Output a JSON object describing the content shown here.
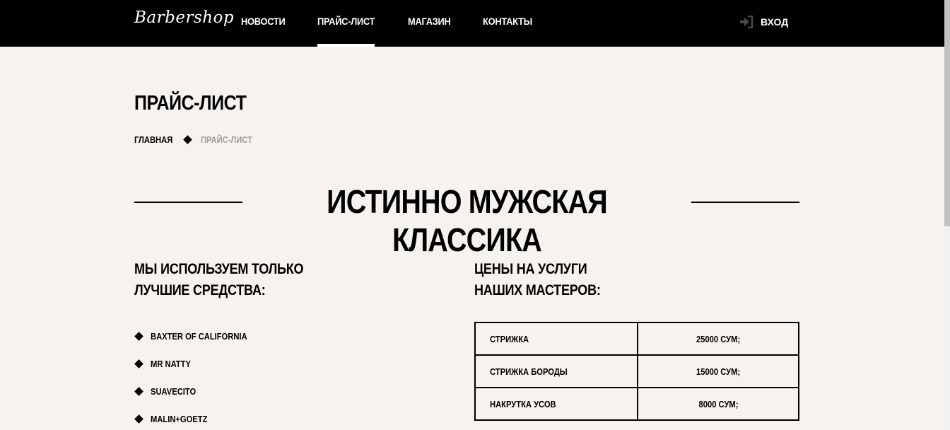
{
  "header": {
    "logo": "Barbershop",
    "nav": [
      {
        "label": "НОВОСТИ",
        "active": false
      },
      {
        "label": "ПРАЙС-ЛИСТ",
        "active": true
      },
      {
        "label": "МАГАЗИН",
        "active": false
      },
      {
        "label": "КОНТАКТЫ",
        "active": false
      }
    ],
    "login_label": "ВХОД",
    "login_icon": "sign-in-icon"
  },
  "page": {
    "title": "ПРАЙС-ЛИСТ",
    "breadcrumb": {
      "home": "ГЛАВНАЯ",
      "current": "ПРАЙС-ЛИСТ"
    }
  },
  "hero": {
    "title": "ИСТИННО МУЖСКАЯ КЛАССИКА"
  },
  "products": {
    "title_line1": "МЫ ИСПОЛЬЗУЕМ ТОЛЬКО",
    "title_line2": "ЛУЧШИЕ СРЕДСТВА:",
    "items": [
      "BAXTER OF CALIFORNIA",
      "MR NATTY",
      "SUAVECITO",
      "MALIN+GOETZ"
    ]
  },
  "prices": {
    "title_line1": "ЦЕНЫ НА УСЛУГИ",
    "title_line2": "НАШИХ МАСТЕРОВ:",
    "rows": [
      {
        "service": "СТРИЖКА",
        "price": "25000 СУМ;"
      },
      {
        "service": "СТРИЖКА БОРОДЫ",
        "price": "15000 СУМ;"
      },
      {
        "service": "НАКРУТКА УСОВ",
        "price": "8000 СУМ;"
      }
    ]
  },
  "colors": {
    "background": "#f6f3ef",
    "header": "#000000",
    "breadcrumb_current": "#9c9c9c"
  }
}
